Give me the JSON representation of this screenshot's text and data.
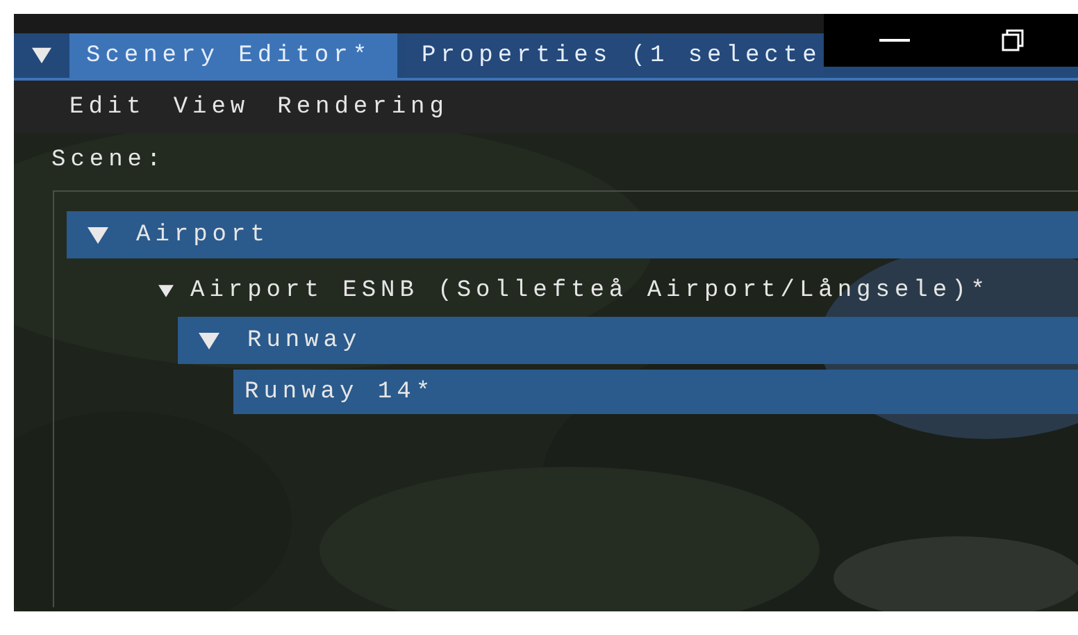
{
  "tabs": [
    {
      "label": "Scenery Editor*",
      "selected": true
    },
    {
      "label": "Properties (1 selecte",
      "selected": false
    }
  ],
  "menu": [
    "Edit",
    "View",
    "Rendering"
  ],
  "scene_label": "Scene:",
  "tree": [
    {
      "label": "Airport",
      "kind": "header",
      "expanded": true,
      "selected": false,
      "children": [
        {
          "label": "Airport ESNB (Sollefteå Airport/Långsele)*",
          "kind": "node",
          "expanded": true,
          "selected": false,
          "children": [
            {
              "label": "Runway",
              "kind": "header",
              "expanded": true,
              "selected": false,
              "children": [
                {
                  "label": "Runway 14*",
                  "kind": "leaf",
                  "selected": true
                }
              ]
            }
          ]
        }
      ]
    }
  ]
}
